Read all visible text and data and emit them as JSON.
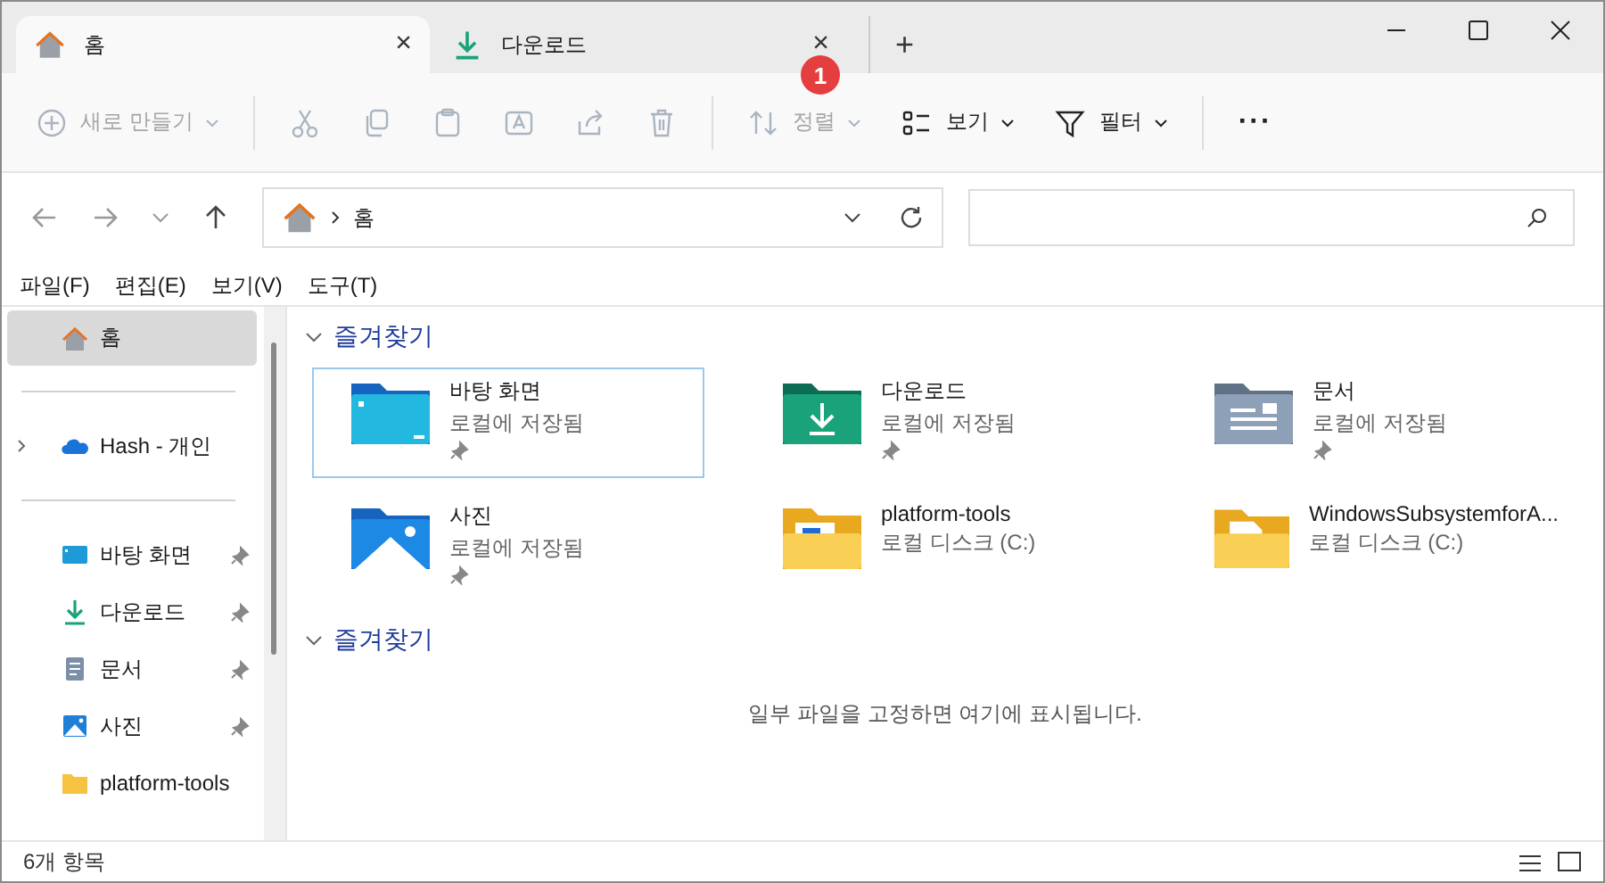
{
  "tabs": [
    {
      "label": "홈",
      "kind": "home",
      "selected": true,
      "close": "×"
    },
    {
      "label": "다운로드",
      "kind": "download",
      "selected": false,
      "close": "×"
    }
  ],
  "new_tab": "+",
  "callout": {
    "label": "1"
  },
  "toolbar": [
    {
      "kind": "new",
      "label": "새로 만들기",
      "disabled": true
    },
    {
      "kind": "cut",
      "disabled": true
    },
    {
      "kind": "copy",
      "disabled": true
    },
    {
      "kind": "paste",
      "disabled": true
    },
    {
      "kind": "rename",
      "disabled": true
    },
    {
      "kind": "share",
      "disabled": true
    },
    {
      "kind": "delete",
      "disabled": true
    },
    {
      "kind": "sort",
      "label": "정렬",
      "disabled": true
    },
    {
      "kind": "view",
      "label": "보기",
      "disabled": false
    },
    {
      "kind": "filter",
      "label": "필터",
      "disabled": false
    },
    {
      "kind": "more",
      "label": "···",
      "disabled": false
    }
  ],
  "address": {
    "crumb": "홈"
  },
  "menu": [
    "파일(F)",
    "편집(E)",
    "보기(V)",
    "도구(T)"
  ],
  "sidebar": {
    "items": [
      {
        "kind": "home",
        "label": "홈",
        "selected": true,
        "pinned": false
      },
      {
        "kind": "cloud",
        "label": "Hash - 개인",
        "selected": false,
        "pinned": false
      },
      {
        "kind": "desktop",
        "label": "바탕 화면",
        "selected": false,
        "pinned": true
      },
      {
        "kind": "download",
        "label": "다운로드",
        "selected": false,
        "pinned": true
      },
      {
        "kind": "documents",
        "label": "문서",
        "selected": false,
        "pinned": true
      },
      {
        "kind": "pictures",
        "label": "사진",
        "selected": false,
        "pinned": true
      },
      {
        "kind": "folder",
        "label": "platform-tools",
        "selected": false,
        "pinned": false
      }
    ]
  },
  "sections": [
    {
      "title": "즐겨찾기",
      "expanded": true,
      "tiles": [
        {
          "kind": "desktop",
          "name": "바탕 화면",
          "location": "로컬에 저장됨",
          "pinned": true,
          "selected": true
        },
        {
          "kind": "download",
          "name": "다운로드",
          "location": "로컬에 저장됨",
          "pinned": true,
          "selected": false
        },
        {
          "kind": "documents",
          "name": "문서",
          "location": "로컬에 저장됨",
          "pinned": true,
          "selected": false
        },
        {
          "kind": "pictures",
          "name": "사진",
          "location": "로컬에 저장됨",
          "pinned": true,
          "selected": false
        },
        {
          "kind": "folder-app",
          "name": "platform-tools",
          "location": "로컬 디스크 (C:)",
          "pinned": false,
          "selected": false
        },
        {
          "kind": "folder-doc",
          "name": "WindowsSubsystemforA...",
          "location": "로컬 디스크 (C:)",
          "pinned": false,
          "selected": false
        }
      ]
    },
    {
      "title": "즐겨찾기",
      "expanded": true,
      "empty_message": "일부 파일을 고정하면 여기에 표시됩니다."
    }
  ],
  "status_bar": {
    "count": "6개 항목"
  }
}
